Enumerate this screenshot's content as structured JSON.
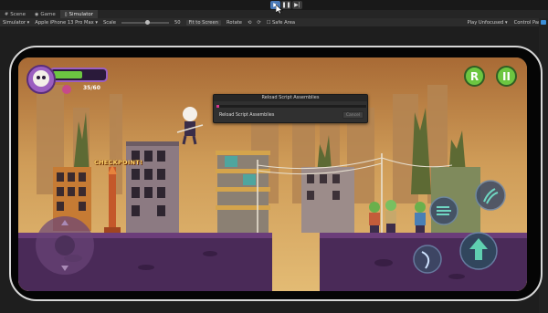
{
  "play_controls": {
    "play": "▶",
    "pause": "❚❚",
    "step": "▶|"
  },
  "tabs": [
    {
      "label": "Scene",
      "icon": "scene-icon"
    },
    {
      "label": "Game",
      "icon": "game-icon"
    },
    {
      "label": "Simulator",
      "icon": "simulator-icon"
    }
  ],
  "toolbar": {
    "mode": "Simulator ▾",
    "device": "Apple iPhone 13 Pro Max ▾",
    "scale_label": "Scale",
    "scale_value": "50",
    "fit_button": "Fit to Screen",
    "rotate_label": "Rotate",
    "safe_area": "Safe Area",
    "play_mode": "Play Unfocused ▾",
    "control_panel": "Control Panel"
  },
  "hud": {
    "hp": "35/60",
    "restart_btn": "R",
    "pause_btn": "II"
  },
  "game": {
    "checkpoint": "CHECKPOINT!"
  },
  "dialog": {
    "title": "Reload Script Assemblies",
    "message": "Reload Script Assemblies",
    "cancel": "Cancel",
    "progress": 0.02
  },
  "colors": {
    "accent": "#d6358c",
    "hud_green": "#6cc641",
    "hud_purple": "#9b5fc0",
    "ground": "#4a2a58"
  }
}
